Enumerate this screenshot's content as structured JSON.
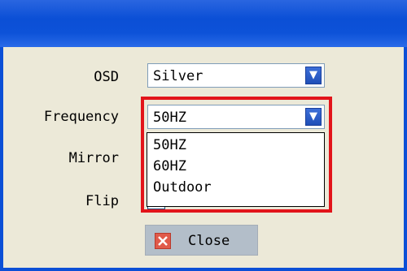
{
  "form": {
    "osd": {
      "label": "OSD",
      "value": "Silver"
    },
    "frequency": {
      "label": "Frequency",
      "value": "50HZ",
      "options": [
        "50HZ",
        "60HZ",
        "Outdoor"
      ]
    },
    "mirror": {
      "label": "Mirror"
    },
    "flip": {
      "label": "Flip"
    }
  },
  "buttons": {
    "close_label": "Close"
  },
  "icons": {
    "dropdown_arrow": "chevron-down-icon",
    "close": "close-icon"
  },
  "colors": {
    "titlebar": "#0b4fd6",
    "highlight": "#e2141a",
    "dialog_bg": "#ece9d8",
    "close_button_bg": "#b3bec9"
  }
}
